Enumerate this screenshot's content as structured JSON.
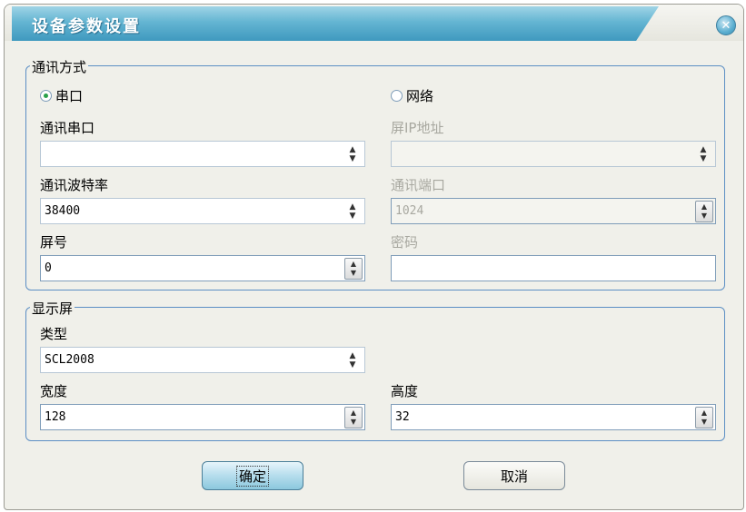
{
  "dialog": {
    "title": "设备参数设置",
    "close_icon": "close-icon"
  },
  "comm": {
    "legend": "通讯方式",
    "radio_serial": {
      "label": "串口",
      "selected": true
    },
    "radio_network": {
      "label": "网络",
      "selected": false
    },
    "serial_port": {
      "label": "通讯串口",
      "value": ""
    },
    "baud_rate": {
      "label": "通讯波特率",
      "value": "38400"
    },
    "screen_no": {
      "label": "屏号",
      "value": "0"
    },
    "ip_address": {
      "label": "屏IP地址",
      "value": ""
    },
    "port": {
      "label": "通讯端口",
      "value": "1024"
    },
    "password": {
      "label": "密码",
      "value": ""
    }
  },
  "display": {
    "legend": "显示屏",
    "type": {
      "label": "类型",
      "value": "SCL2008"
    },
    "width": {
      "label": "宽度",
      "value": "128"
    },
    "height": {
      "label": "高度",
      "value": "32"
    }
  },
  "buttons": {
    "ok": "确定",
    "cancel": "取消"
  },
  "colors": {
    "accent": "#64b5d2",
    "group_border": "#5c8fc4",
    "radio_selected": "#2aa14a"
  }
}
